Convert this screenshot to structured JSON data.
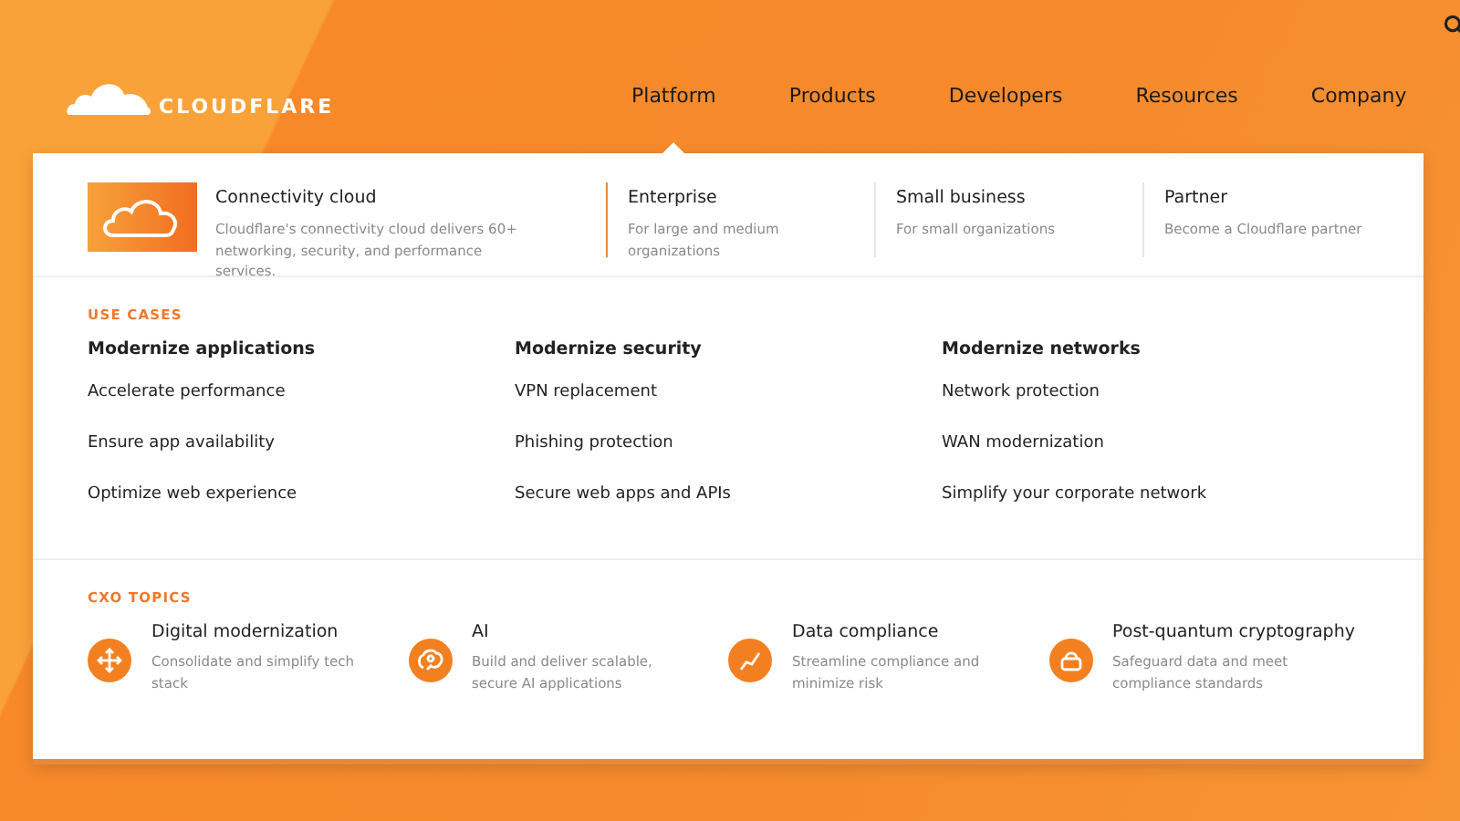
{
  "logo": {
    "text": "CLOUDFLARE"
  },
  "nav": [
    {
      "label": "Platform",
      "selected": true
    },
    {
      "label": "Products",
      "selected": false
    },
    {
      "label": "Developers",
      "selected": false
    },
    {
      "label": "Resources",
      "selected": false
    },
    {
      "label": "Company",
      "selected": false
    }
  ],
  "featured": {
    "title": "Connectivity cloud",
    "description": "Cloudflare's connectivity cloud delivers 60+ networking, security, and performance services."
  },
  "segments": [
    {
      "title": "Enterprise",
      "description": "For large and medium organizations",
      "selected": true
    },
    {
      "title": "Small business",
      "description": "For small organizations",
      "selected": false
    },
    {
      "title": "Partner",
      "description": "Become a Cloudflare partner",
      "selected": false
    }
  ],
  "use_cases": {
    "heading": "USE CASES",
    "columns": [
      {
        "title": "Modernize applications",
        "links": [
          "Accelerate performance",
          "Ensure app availability",
          "Optimize web experience"
        ]
      },
      {
        "title": "Modernize security",
        "links": [
          "VPN replacement",
          "Phishing protection",
          "Secure web apps and APIs"
        ]
      },
      {
        "title": "Modernize networks",
        "links": [
          "Network protection",
          "WAN modernization",
          "Simplify your corporate network"
        ]
      }
    ]
  },
  "cxo_topics": {
    "heading": "CXO TOPICS",
    "items": [
      {
        "kind": "arrows",
        "title": "Digital modernization",
        "description": "Consolidate and simplify tech stack"
      },
      {
        "kind": "brain",
        "title": "AI",
        "description": "Build and deliver scalable, secure AI applications"
      },
      {
        "kind": "chart",
        "title": "Data compliance",
        "description": "Streamline compliance and minimize risk"
      },
      {
        "kind": "lock",
        "title": "Post-quantum cryptography",
        "description": "Safeguard data and meet compliance standards"
      }
    ]
  }
}
